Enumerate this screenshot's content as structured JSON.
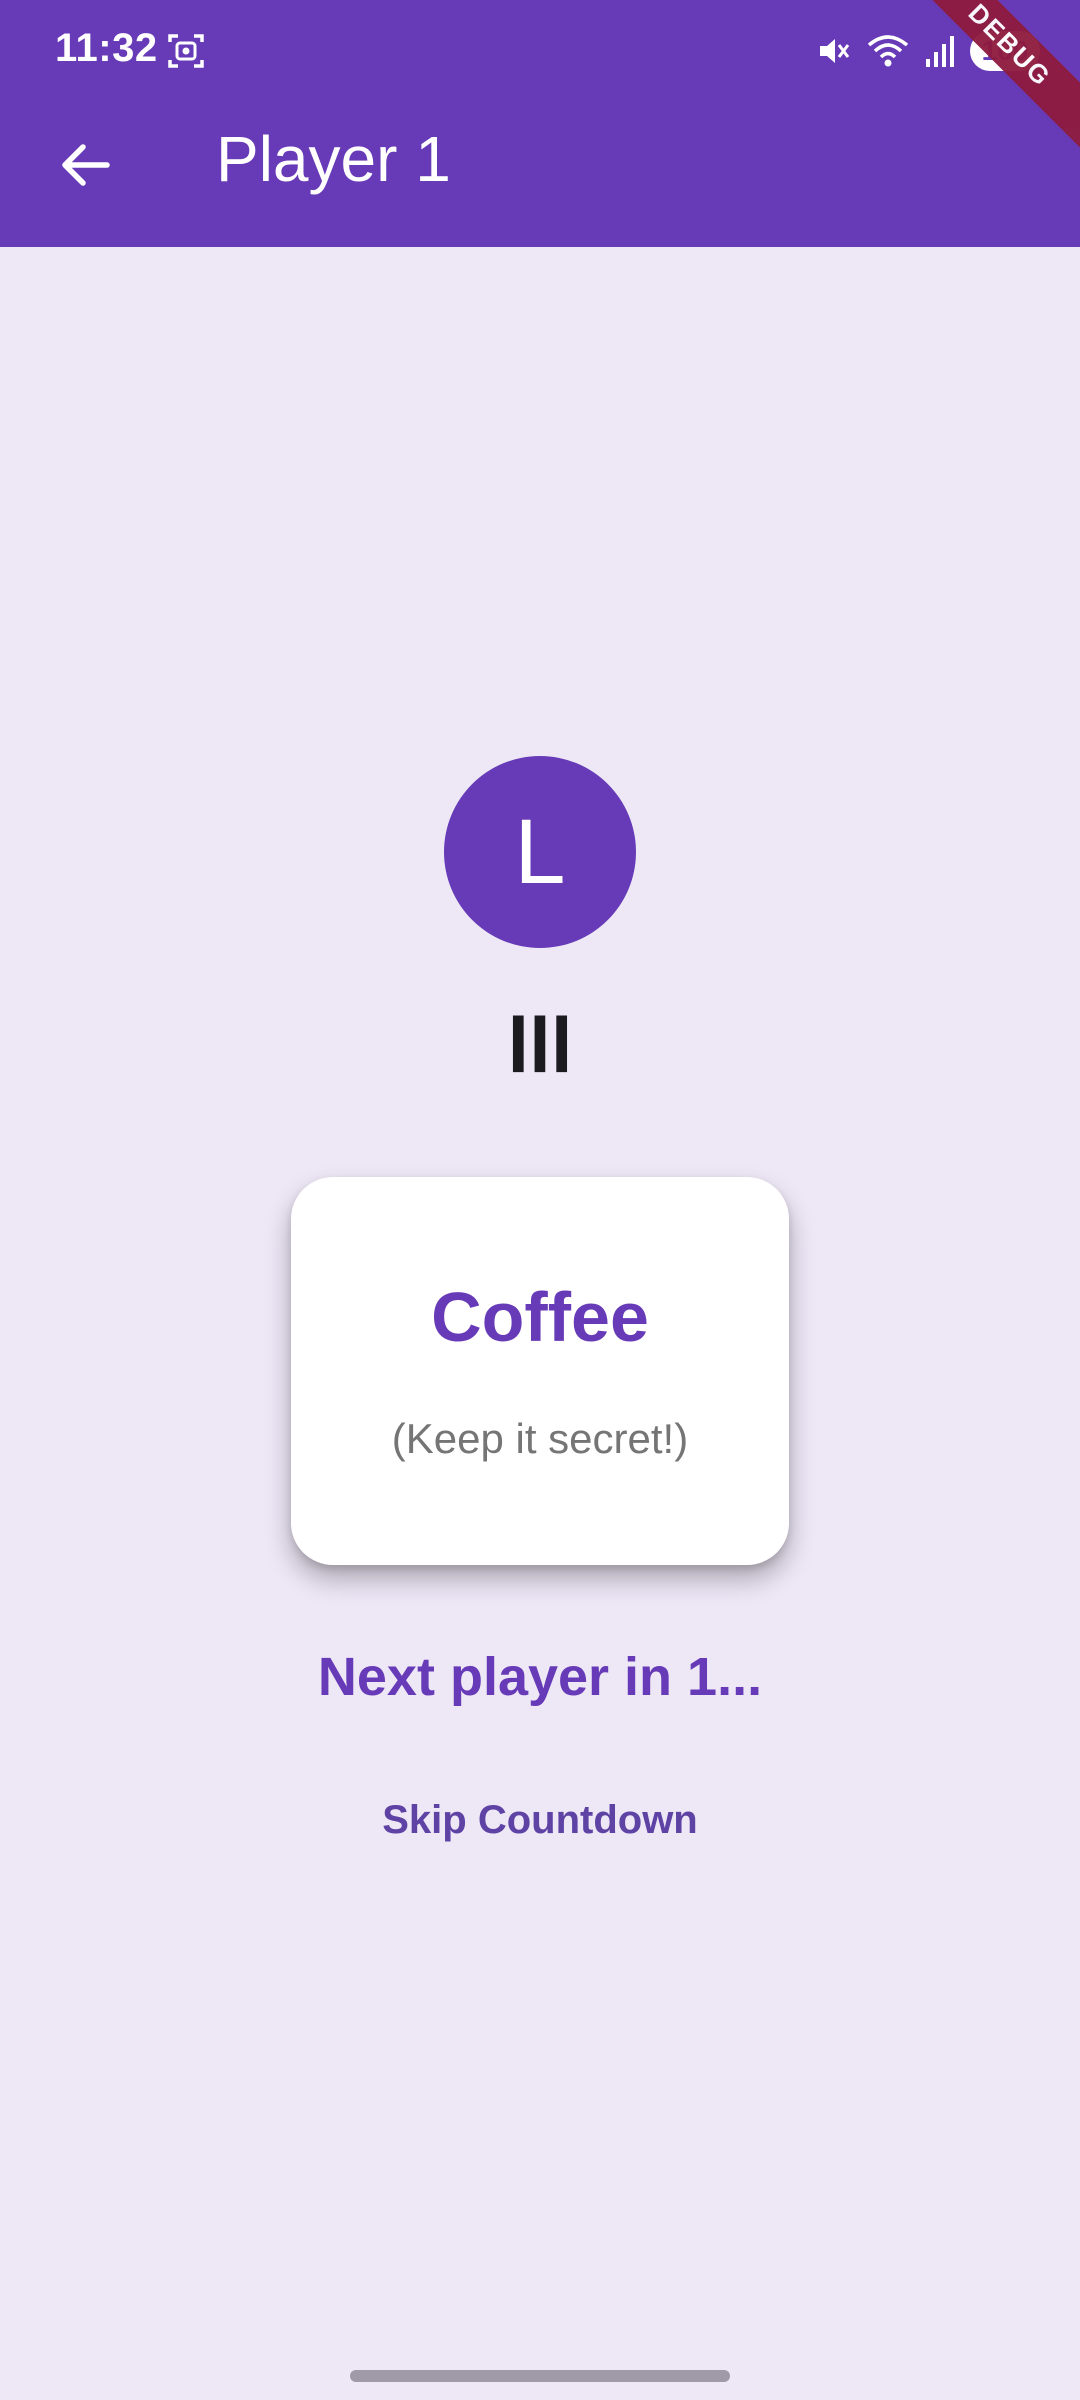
{
  "status_bar": {
    "time": "11:32",
    "battery": "100",
    "icons": [
      "screenshot-icon",
      "mute-icon",
      "wifi-icon",
      "signal-icon",
      "battery-icon"
    ]
  },
  "debug_banner": "DEBUG",
  "app_bar": {
    "title": "Player 1",
    "back_icon": "arrow-back-icon"
  },
  "player": {
    "avatar_letter": "L",
    "name": "lll"
  },
  "word_card": {
    "word": "Coffee",
    "hint": "(Keep it secret!)"
  },
  "countdown_text": "Next player in 1...",
  "skip_label": "Skip Countdown",
  "colors": {
    "primary": "#673ab7",
    "background": "#ede7f6",
    "card": "#ffffff",
    "hint_text": "#757575"
  }
}
